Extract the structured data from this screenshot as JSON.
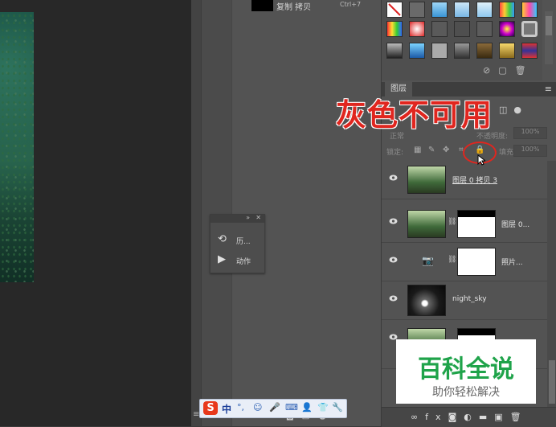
{
  "history": {
    "item_label": "复制 拷贝",
    "shortcut": "Ctrl+7"
  },
  "mini_panel": {
    "items": [
      {
        "label": "历...",
        "icon": "history-icon"
      },
      {
        "label": "动作",
        "icon": "actions-play-icon"
      }
    ]
  },
  "layers_panel": {
    "tab_label": "图层",
    "blend_mode": "正常",
    "opacity_label": "不透明度:",
    "opacity_value": "100%",
    "lock_label": "锁定:",
    "fill_label": "填充:",
    "fill_value": "100%",
    "layers": [
      {
        "name": "图层 0 拷贝 3",
        "has_mask": false,
        "thumb": "forest"
      },
      {
        "name": "图层 0...",
        "has_mask": true,
        "thumb": "forest"
      },
      {
        "name": "照片...",
        "has_mask": true,
        "thumb": "adjustment"
      },
      {
        "name": "night_sky",
        "has_mask": false,
        "thumb": "night"
      },
      {
        "name": "",
        "has_mask": true,
        "thumb": "forest"
      }
    ]
  },
  "annotation": {
    "text": "灰色不可用",
    "color": "#e0261f"
  },
  "watermark": {
    "title": "百科全说",
    "subtitle": "助你轻松解决",
    "title_color": "#1fa34a"
  },
  "ime": {
    "logo": "S",
    "mode": "中"
  }
}
